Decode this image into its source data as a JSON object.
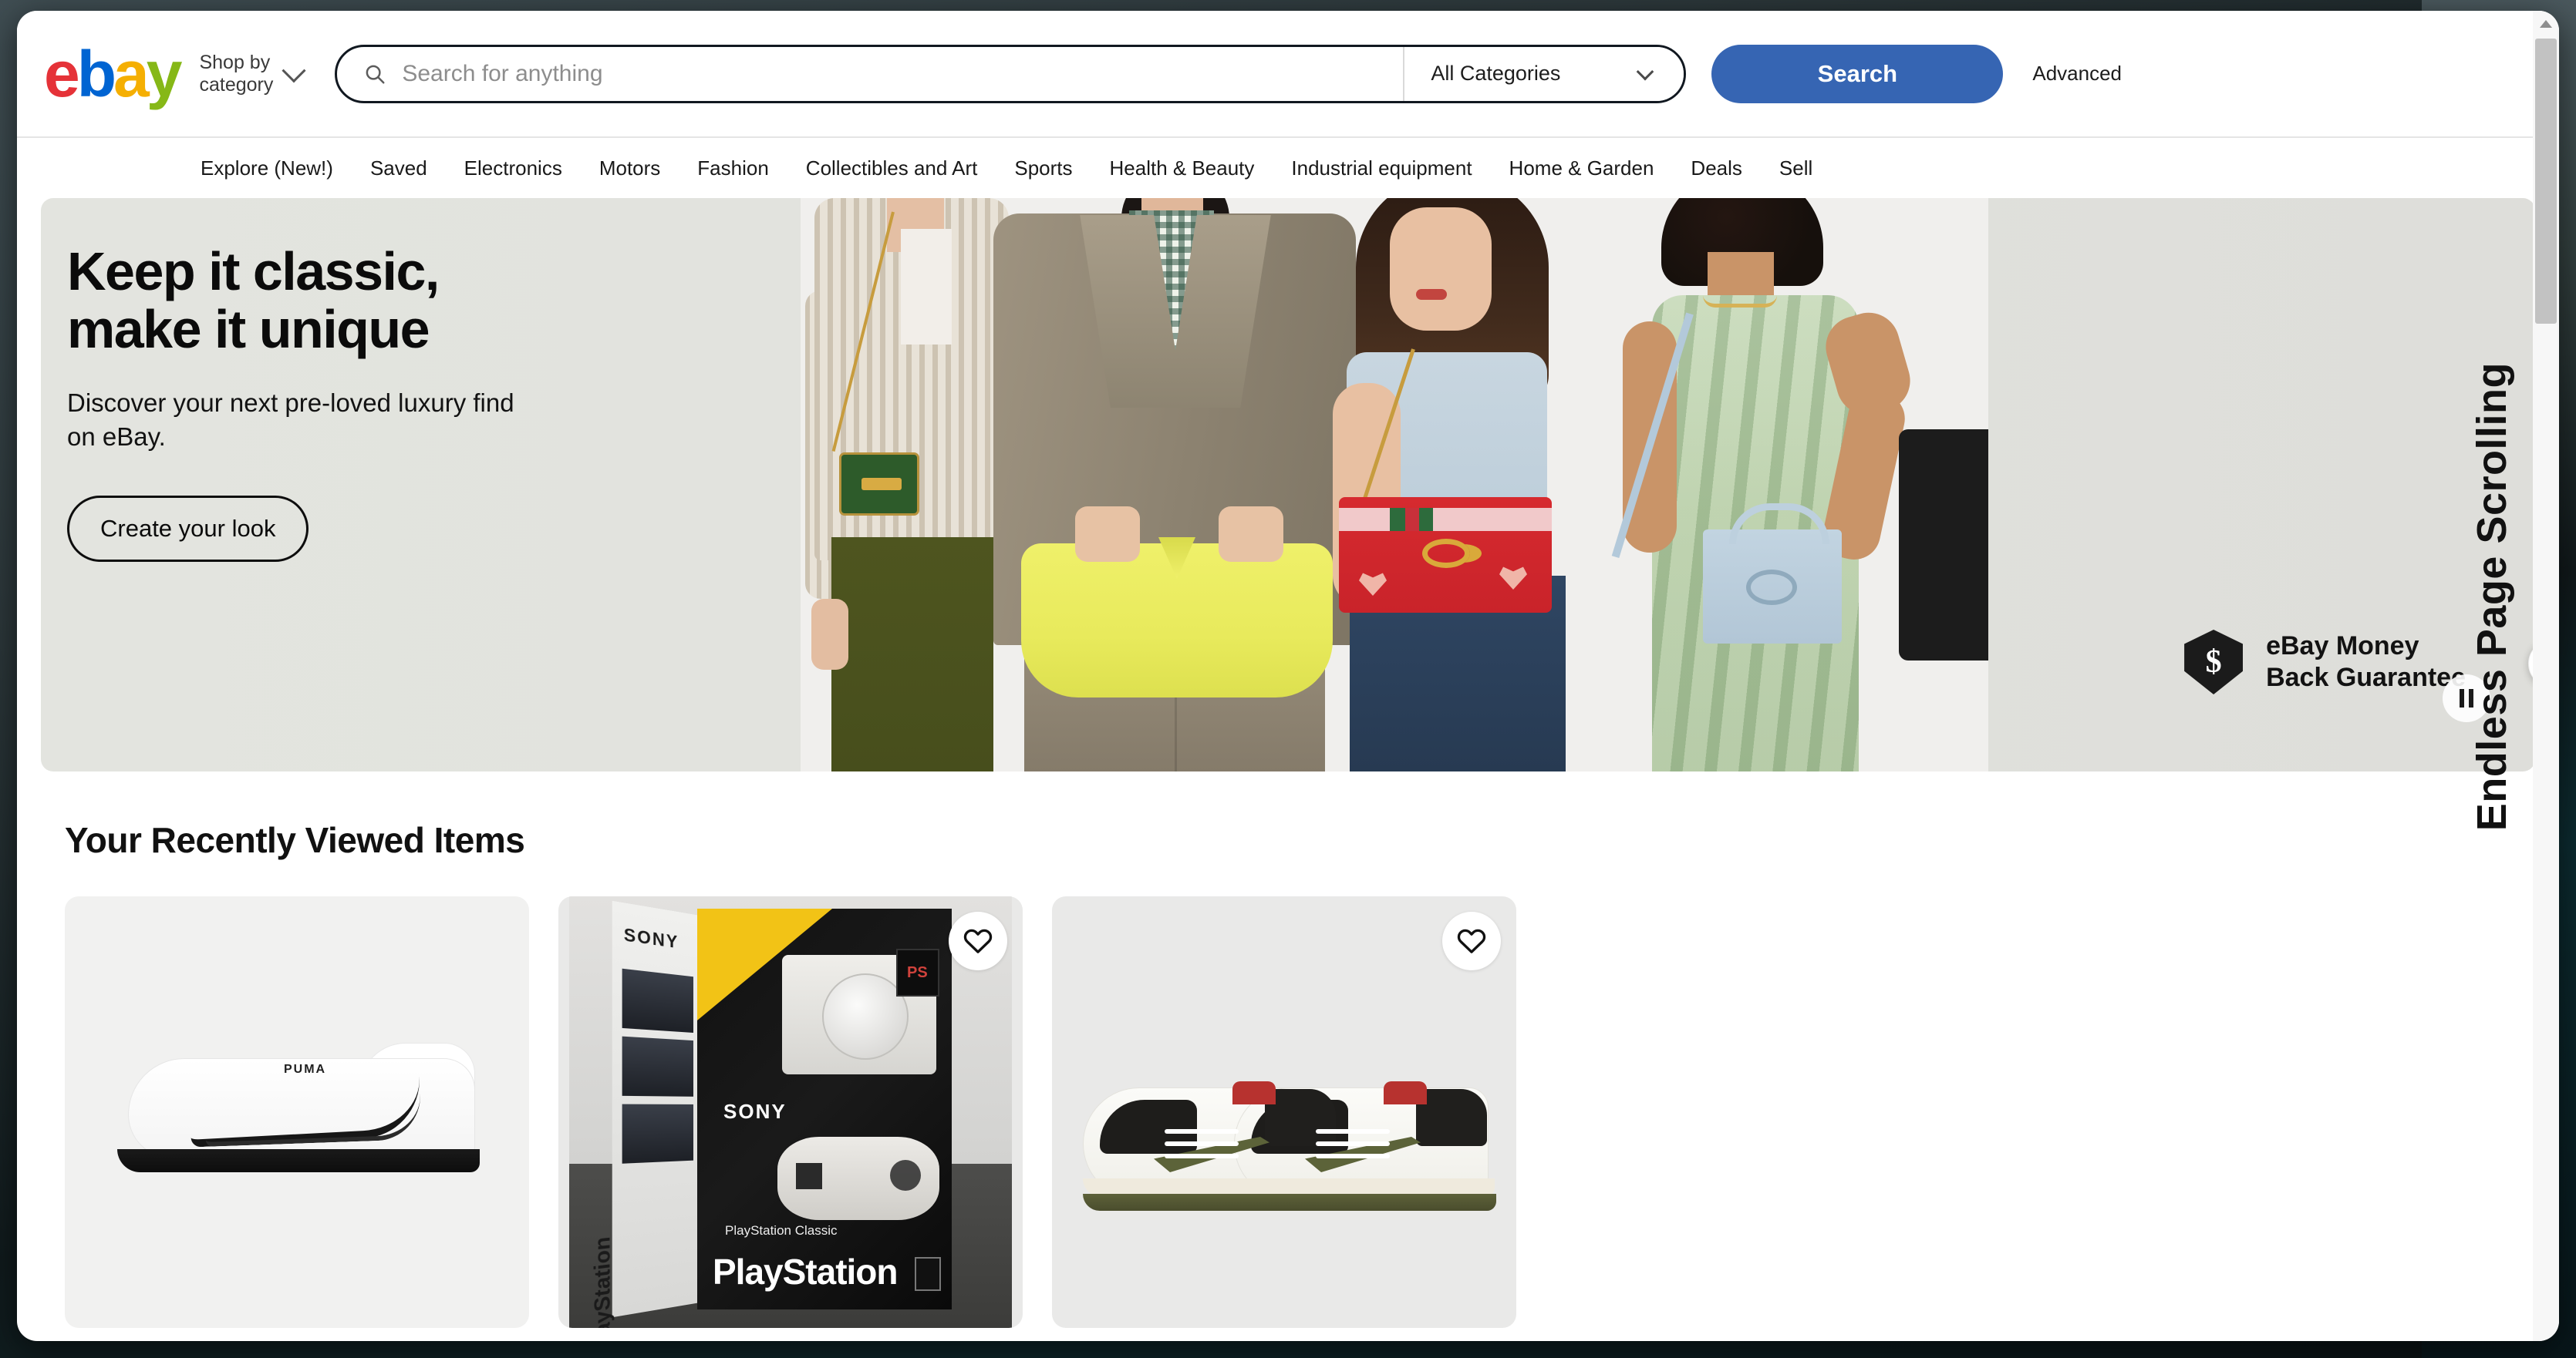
{
  "brand": {
    "name": "ebay",
    "letters": [
      "e",
      "b",
      "a",
      "y"
    ],
    "colors": {
      "e": "#e53238",
      "b": "#0064d2",
      "a": "#f5af02",
      "y": "#86b817",
      "search_button": "#3665b3"
    }
  },
  "header": {
    "shop_by_category": "Shop by\ncategory",
    "search": {
      "placeholder": "Search for anything",
      "value": "",
      "icon": "search-icon"
    },
    "category_select": {
      "selected": "All Categories",
      "icon": "chevron-down-icon"
    },
    "search_button_label": "Search",
    "advanced_link": "Advanced"
  },
  "nav": {
    "items": [
      {
        "label": "Explore (New!)"
      },
      {
        "label": "Saved"
      },
      {
        "label": "Electronics"
      },
      {
        "label": "Motors"
      },
      {
        "label": "Fashion"
      },
      {
        "label": "Collectibles and Art"
      },
      {
        "label": "Sports"
      },
      {
        "label": "Health & Beauty"
      },
      {
        "label": "Industrial equipment"
      },
      {
        "label": "Home & Garden"
      },
      {
        "label": "Deals"
      },
      {
        "label": "Sell"
      }
    ]
  },
  "hero": {
    "title": "Keep it classic,\nmake it unique",
    "subtitle": "Discover your next pre-loved luxury find\non eBay.",
    "cta_label": "Create your look",
    "badge": {
      "text": "eBay Money\nBack Guarantee",
      "icon": "dollar-shield-icon",
      "symbol": "$"
    },
    "pause_control": "pause-icon",
    "next_control": "chevron-right-icon"
  },
  "recently_viewed": {
    "title": "Your Recently Viewed Items",
    "items": [
      {
        "name": "puma-sneaker",
        "brand_mark": "PUMA",
        "watchlisted": false,
        "has_watch_button": false
      },
      {
        "name": "playstation-classic-box",
        "brand_mark": "SONY",
        "product_word": "PlayStation",
        "sub_word": "PlayStation Classic",
        "watchlisted": false,
        "has_watch_button": true
      },
      {
        "name": "jordan-low-sneakers",
        "brand_mark": "",
        "watchlisted": false,
        "has_watch_button": true
      }
    ]
  },
  "annotation": {
    "vertical_label": "Endless Page Scrolling"
  },
  "scrollbar": {
    "up_arrow": "triangle-up-icon",
    "position_percent": 2
  }
}
